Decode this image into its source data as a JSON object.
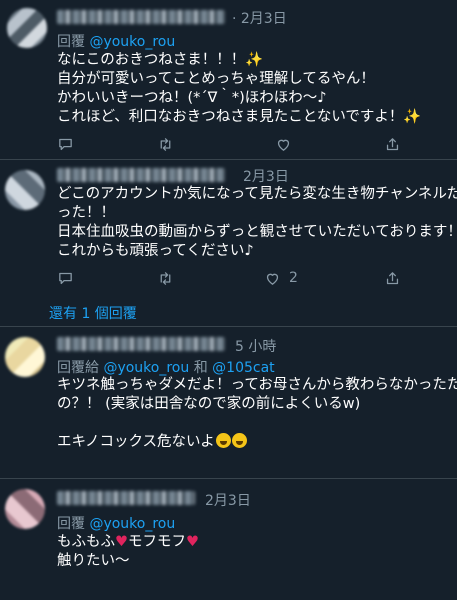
{
  "tweets": [
    {
      "time": "· 2月3日",
      "reply_prefix": "回覆",
      "mentions": "@youko_rou",
      "lines": [
        "なにこのおきつねさま！！！",
        "自分が可愛いってことめっちゃ理解してるやん！",
        "かわいいきーつね！(*´∇｀*)ほわほわ〜♪",
        "これほど、利口なおきつねさま見たことないですよ！"
      ],
      "replies": "",
      "retweets": "",
      "likes": ""
    },
    {
      "time": "2月3日",
      "lines": [
        "どこのアカウントか気になって見たら変な生き物チャンネルだ",
        "った！！",
        "日本住血吸虫の動画からずっと観させていただいております！",
        "これからも頑張ってください♪"
      ],
      "replies": "",
      "retweets": "",
      "likes": "2",
      "more_replies": "還有 1 個回覆"
    },
    {
      "time": "5 小時",
      "reply_prefix": "回覆給",
      "mentions": "@youko_rou",
      "conj": "和",
      "mentions2": "@105cat",
      "lines": [
        "キツネ触っちゃダメだよ！ってお母さんから教わらなかったた",
        "の？！ (実家は田舎なので家の前によくいるw)",
        "",
        "エキノコックス危ないよ"
      ]
    },
    {
      "time": "2月3日",
      "reply_prefix": "回覆",
      "mentions": "@youko_rou",
      "lines": [
        "もふもふ",
        "モフモフ",
        "触りたい〜"
      ]
    }
  ],
  "icons": [
    "reply-icon",
    "retweet-icon",
    "like-icon",
    "share-icon"
  ],
  "colors": {
    "background": "#15202b",
    "muted": "#8899a6",
    "link": "#1da1f2",
    "divider": "#38444d"
  }
}
